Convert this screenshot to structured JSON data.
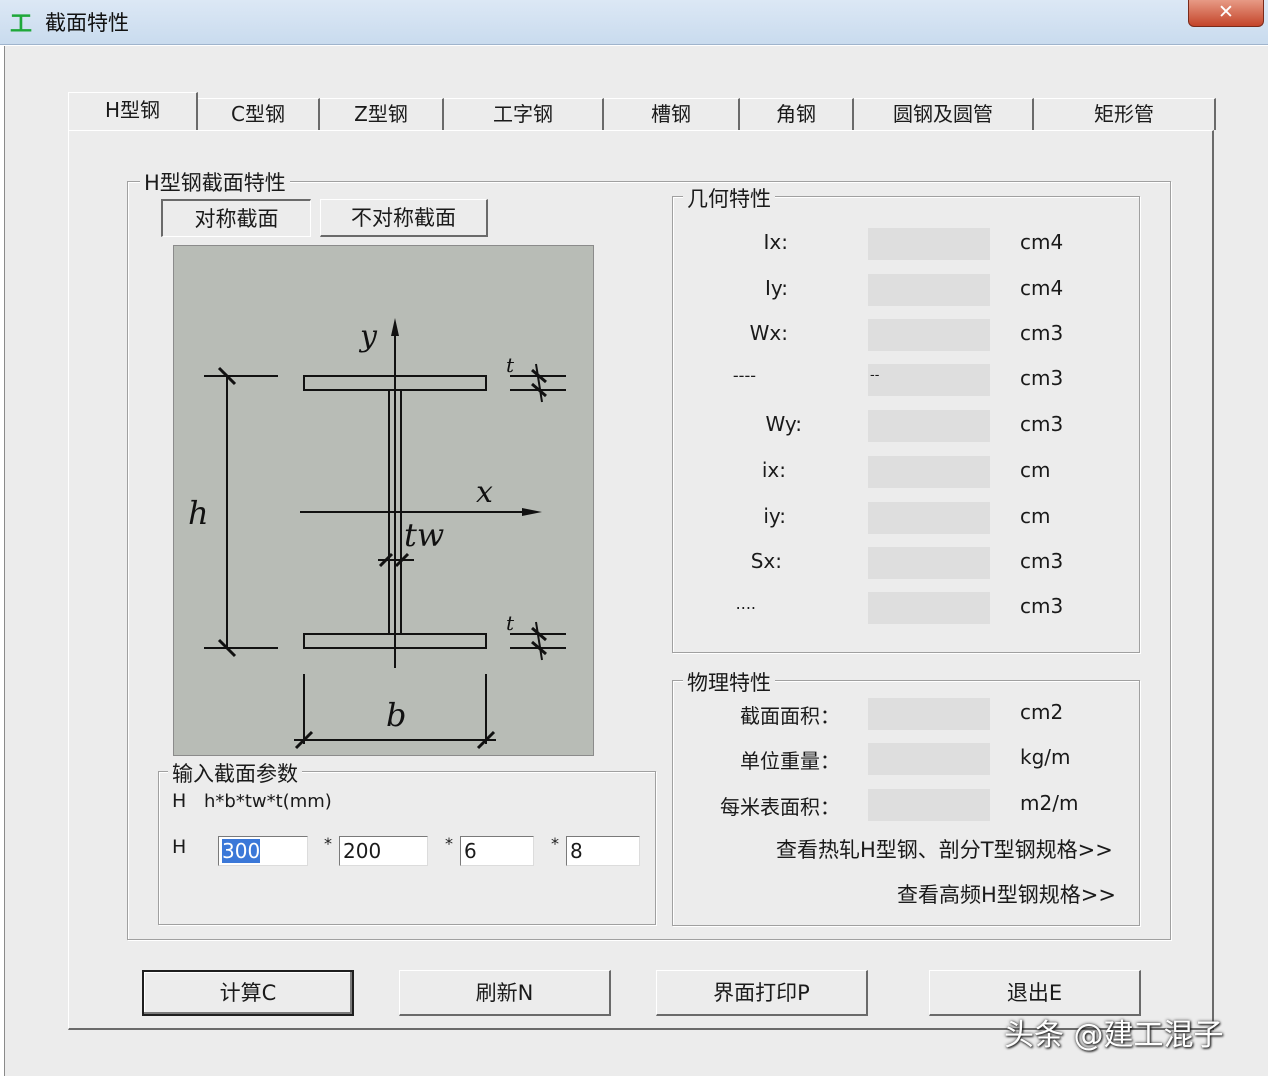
{
  "title_bar": {
    "icon": "工",
    "title": "截面特性",
    "close": "✕"
  },
  "tabs": [
    "H型钢",
    "C型钢",
    "Z型钢",
    "工字钢",
    "槽钢",
    "角钢",
    "圆钢及圆管",
    "矩形管"
  ],
  "section_group": {
    "label": "H型钢截面特性",
    "sym_button": "对称截面",
    "asym_button": "不对称截面"
  },
  "diagram_labels": {
    "y": "y",
    "x": "x",
    "h": "h",
    "b": "b",
    "tw": "tw",
    "t_top": "t",
    "t_bottom": "t"
  },
  "input_group": {
    "label": "输入截面参数",
    "formula_prefix": "H",
    "formula": "h*b*tw*t(mm)",
    "row_prefix": "H",
    "times": "*",
    "h_value": "300",
    "b_value": "200",
    "tw_value": "6",
    "t_value": "8"
  },
  "geometry": {
    "label": "几何特性",
    "rows": [
      {
        "name": "Ix:",
        "extra": "",
        "unit": "cm4"
      },
      {
        "name": "Iy:",
        "extra": "",
        "unit": "cm4"
      },
      {
        "name": "Wx:",
        "extra": "",
        "unit": "cm3"
      },
      {
        "name": "----",
        "extra": "--",
        "unit": "cm3"
      },
      {
        "name": "Wy:",
        "extra": "",
        "unit": "cm3"
      },
      {
        "name": "ix:",
        "extra": "",
        "unit": "cm"
      },
      {
        "name": "iy:",
        "extra": "",
        "unit": "cm"
      },
      {
        "name": "Sx:",
        "extra": "",
        "unit": "cm3"
      },
      {
        "name": "....",
        "extra": "",
        "unit": "cm3"
      }
    ]
  },
  "physical": {
    "label": "物理特性",
    "rows": [
      {
        "name": "截面面积：",
        "unit": "cm2"
      },
      {
        "name": "单位重量：",
        "unit": "kg/m"
      },
      {
        "name": "每米表面积：",
        "unit": "m2/m"
      }
    ],
    "link_hot_rolled": "查看热轧H型钢、剖分T型钢规格>>",
    "link_high_freq": "查看高频H型钢规格>>"
  },
  "buttons": {
    "calc": "计算C",
    "refresh": "刷新N",
    "print": "界面打印P",
    "exit": "退出E"
  },
  "watermark": "头条 @建工混子"
}
